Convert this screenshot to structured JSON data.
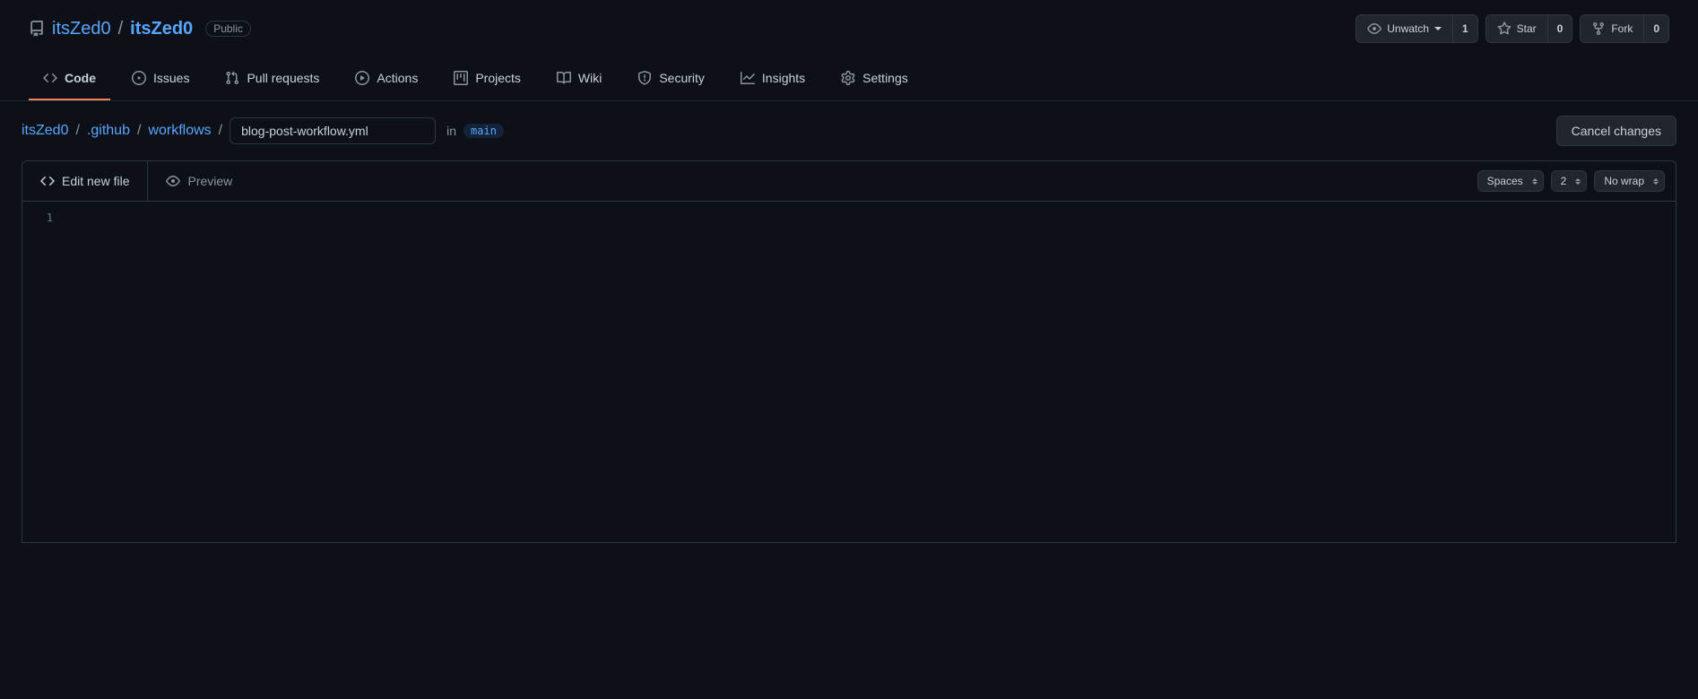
{
  "header": {
    "owner": "itsZed0",
    "repo": "itsZed0",
    "visibility": "Public",
    "unwatch_label": "Unwatch",
    "watch_count": "1",
    "star_label": "Star",
    "star_count": "0",
    "fork_label": "Fork",
    "fork_count": "0"
  },
  "nav": {
    "code": "Code",
    "issues": "Issues",
    "pulls": "Pull requests",
    "actions": "Actions",
    "projects": "Projects",
    "wiki": "Wiki",
    "security": "Security",
    "insights": "Insights",
    "settings": "Settings"
  },
  "breadcrumb": {
    "root": "itsZed0",
    "dir1": ".github",
    "dir2": "workflows",
    "filename": "blog-post-workflow.yml",
    "in_label": "in",
    "branch": "main",
    "cancel": "Cancel changes"
  },
  "editor": {
    "tab_edit": "Edit new file",
    "tab_preview": "Preview",
    "indent_mode": "Spaces",
    "indent_size": "2",
    "wrap_mode": "No wrap",
    "line1": "1"
  }
}
